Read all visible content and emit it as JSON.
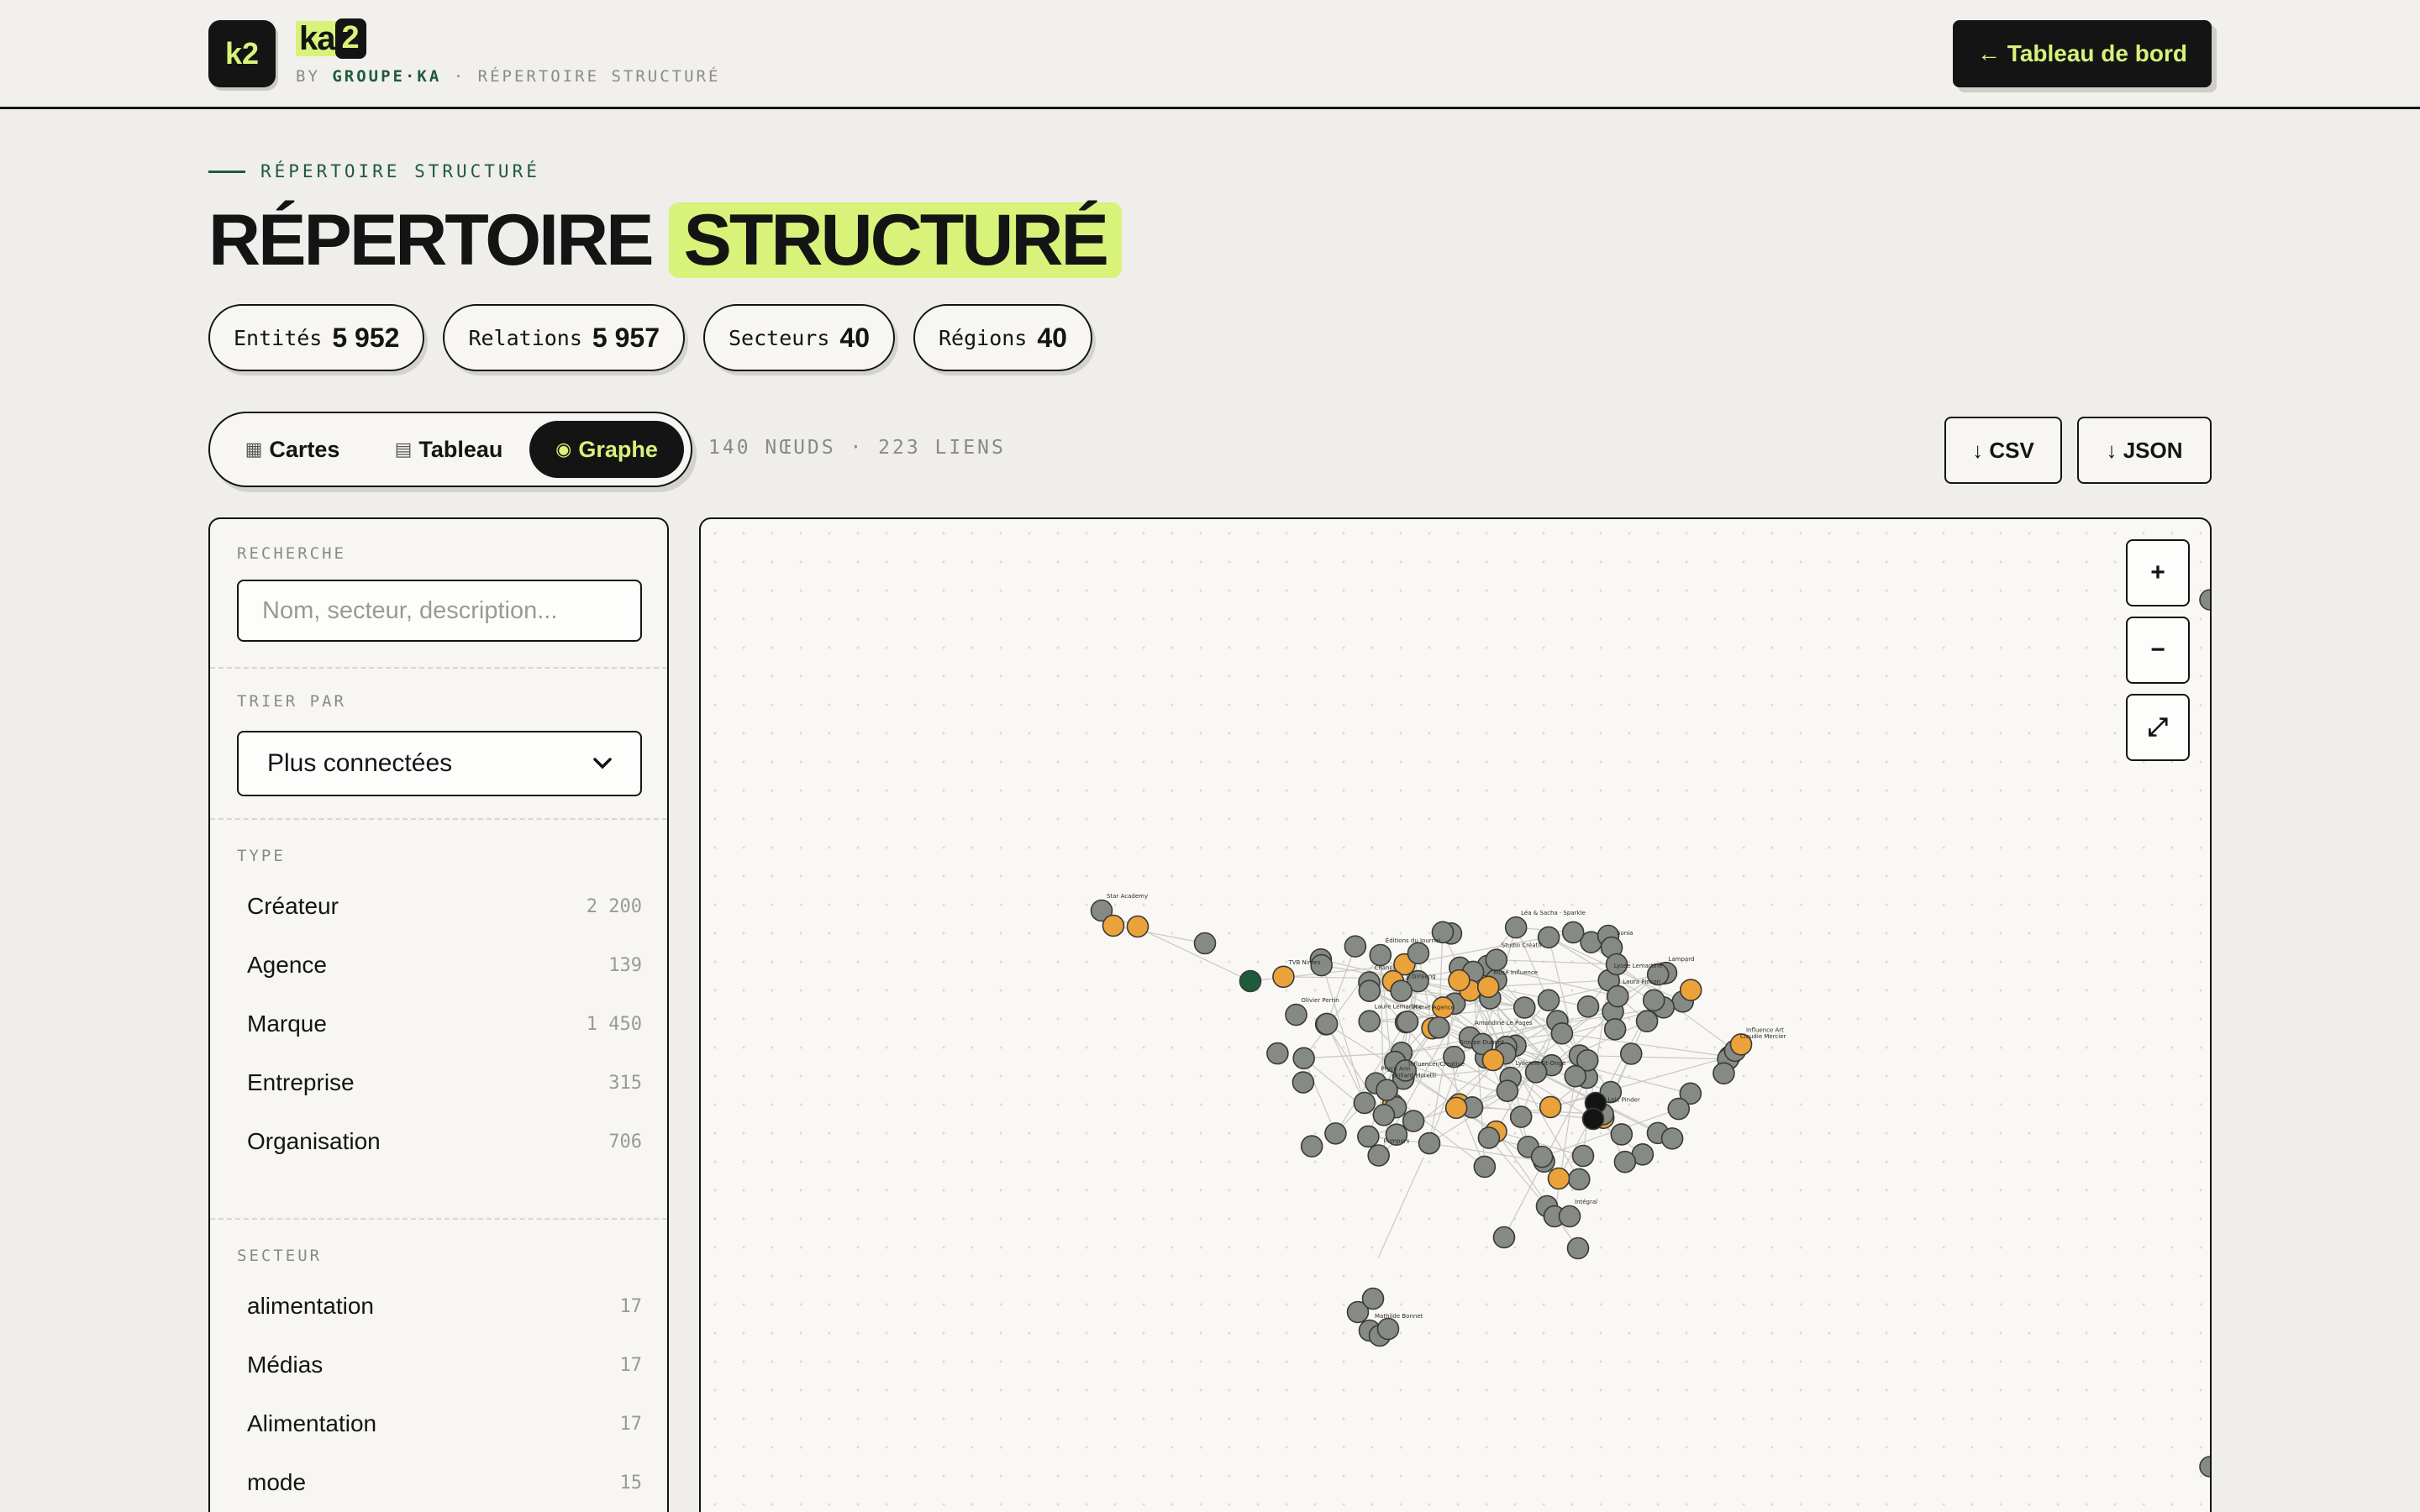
{
  "brand": {
    "logo_k2": "k2",
    "logo_ka": "ka",
    "logo_two": "2",
    "by_prefix": "BY",
    "by_group": "GROUPE·KA",
    "by_suffix": "· RÉPERTOIRE STRUCTURÉ"
  },
  "topbar": {
    "dashboard_button": "← Tableau de bord"
  },
  "header": {
    "eyebrow": "RÉPERTOIRE STRUCTURÉ",
    "title_plain": "RÉPERTOIRE",
    "title_highlight": "STRUCTURÉ"
  },
  "stats": [
    {
      "label": "Entités",
      "value": "5 952"
    },
    {
      "label": "Relations",
      "value": "5 957"
    },
    {
      "label": "Secteurs",
      "value": "40"
    },
    {
      "label": "Régions",
      "value": "40"
    }
  ],
  "views": [
    {
      "icon": "▦",
      "label": "Cartes",
      "active": false
    },
    {
      "icon": "▤",
      "label": "Tableau",
      "active": false
    },
    {
      "icon": "◉",
      "label": "Graphe",
      "active": true
    }
  ],
  "graph_info": "140 NŒUDS · 223 LIENS",
  "export": {
    "csv": "↓ CSV",
    "json": "↓ JSON"
  },
  "sidebar": {
    "search_label": "RECHERCHE",
    "search_placeholder": "Nom, secteur, description...",
    "sort_label": "TRIER PAR",
    "sort_value": "Plus connectées",
    "type_label": "TYPE",
    "types": [
      {
        "label": "Créateur",
        "count": "2 200"
      },
      {
        "label": "Agence",
        "count": "139"
      },
      {
        "label": "Marque",
        "count": "1 450"
      },
      {
        "label": "Entreprise",
        "count": "315"
      },
      {
        "label": "Organisation",
        "count": "706"
      }
    ],
    "sector_label": "SECTEUR",
    "sectors": [
      {
        "label": "alimentation",
        "count": "17"
      },
      {
        "label": "Médias",
        "count": "17"
      },
      {
        "label": "Alimentation",
        "count": "17"
      },
      {
        "label": "mode",
        "count": "15"
      }
    ]
  },
  "zoom": {
    "in": "+",
    "out": "−",
    "fit": "⤢"
  },
  "colors": {
    "accent_lime": "#d8f27a",
    "ink": "#141414",
    "node_grey": "#858a85",
    "node_orange": "#eba23a",
    "node_green": "#1f5a3c",
    "node_black": "#141414"
  },
  "graph_labels": [
    "Pumpers",
    "Amandine Le Pages",
    "Chanel",
    "Pryce Ann",
    "Influencer/Creative",
    "Grillard Moretti",
    "Lycée Lemartine",
    "Laure Lemartine",
    "Lyllenne St-Onge",
    "Lampard",
    "Pianet Agence",
    "Loic Pinder",
    "Olivier Perrin",
    "Groupe Dupont",
    "Claudie Mercier",
    "Laura Pinson",
    "Influence Art",
    "Léa & Sacha · Sparkle",
    "Musé Influence",
    "Jr.Ginseng",
    "Studio Créatif",
    "TVB Nimes",
    "Éditions du Journal",
    "Star Academy",
    "Sonia",
    "Intégral",
    "Mathilde Bonnet"
  ]
}
